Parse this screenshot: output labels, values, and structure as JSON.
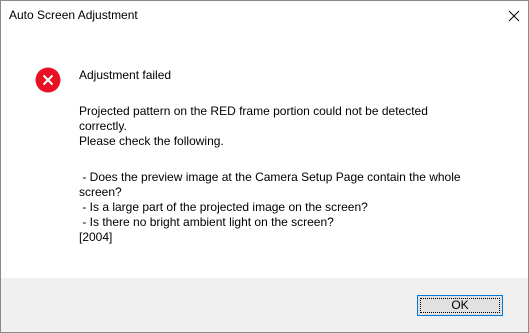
{
  "window": {
    "title": "Auto Screen Adjustment",
    "close_icon": "close-icon"
  },
  "message": {
    "icon": "error-icon",
    "heading": "Adjustment failed",
    "lines": [
      "Projected pattern on the RED frame portion could not be detected",
      "correctly.",
      "Please check the following.",
      " - Does the preview image at the Camera Setup Page contain the whole",
      "screen?",
      " - Is a large part of the projected image on the screen?",
      " - Is there no bright ambient light on the screen?",
      "[2004]"
    ]
  },
  "buttons": {
    "ok_label": "OK"
  },
  "colors": {
    "error_red": "#e81123",
    "footer_bg": "#f0f0f0",
    "focus_border": "#0078d7"
  }
}
